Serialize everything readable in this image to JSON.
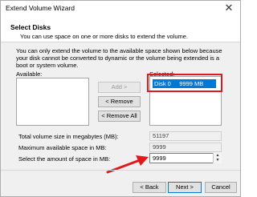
{
  "window": {
    "title": "Extend Volume Wizard",
    "close_glyph": "✕"
  },
  "header": {
    "title": "Select Disks",
    "subtitle": "You can use space on one or more disks to extend the volume."
  },
  "description": "You can only extend the volume to the available space shown below because your disk cannot be converted to dynamic or the volume being extended is a boot or system volume.",
  "available": {
    "label": "Available:",
    "items": []
  },
  "selected": {
    "label": "Selected:",
    "items": [
      {
        "text": "Disk 0     9999 MB"
      }
    ]
  },
  "buttons": {
    "add": "Add >",
    "remove": "< Remove",
    "remove_all": "< Remove All",
    "back": "< Back",
    "next": "Next >",
    "cancel": "Cancel"
  },
  "fields": {
    "total_size": {
      "label": "Total volume size in megabytes (MB):",
      "value": "51197"
    },
    "max_space": {
      "label": "Maximum available space in MB:",
      "value": "9999"
    },
    "amount": {
      "label": "Select the amount of space in MB:",
      "value": "9999"
    }
  },
  "annotations": {
    "highlight_color": "#e0191d",
    "arrow_color": "#e0191d"
  },
  "colors": {
    "selection": "#0078d7",
    "dialog_bg": "#f0f0f0"
  }
}
